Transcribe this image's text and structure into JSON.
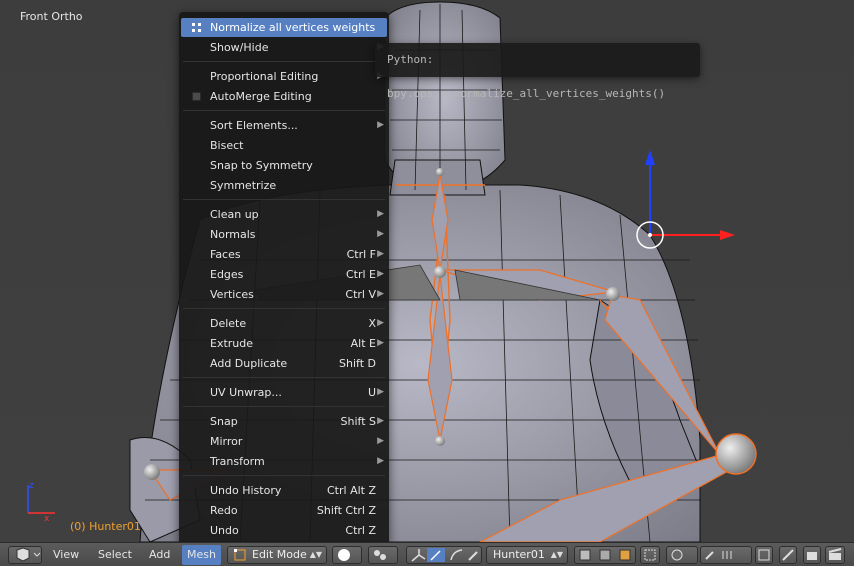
{
  "viewport": {
    "view_name": "Front Ortho",
    "object_label": "(0) Hunter01"
  },
  "menu": {
    "items": [
      {
        "label": "Normalize all vertices weights",
        "shortcut": "",
        "submenu": false,
        "highlighted": true,
        "icon": "vertex-group-icon"
      },
      {
        "label": "Show/Hide",
        "shortcut": "",
        "submenu": true
      },
      {
        "label": "Proportional Editing",
        "shortcut": "",
        "submenu": true
      },
      {
        "label": "AutoMerge Editing",
        "shortcut": "",
        "submenu": false,
        "icon": "checkbox-icon",
        "checked": false
      },
      {
        "label": "Sort Elements...",
        "shortcut": "",
        "submenu": true
      },
      {
        "label": "Bisect",
        "shortcut": "",
        "submenu": false
      },
      {
        "label": "Snap to Symmetry",
        "shortcut": "",
        "submenu": false
      },
      {
        "label": "Symmetrize",
        "shortcut": "",
        "submenu": false
      },
      {
        "label": "Clean up",
        "shortcut": "",
        "submenu": true
      },
      {
        "label": "Normals",
        "shortcut": "",
        "submenu": true
      },
      {
        "label": "Faces",
        "shortcut": "Ctrl F",
        "submenu": true
      },
      {
        "label": "Edges",
        "shortcut": "Ctrl E",
        "submenu": true
      },
      {
        "label": "Vertices",
        "shortcut": "Ctrl V",
        "submenu": true
      },
      {
        "label": "Delete",
        "shortcut": "X",
        "submenu": true
      },
      {
        "label": "Extrude",
        "shortcut": "Alt E",
        "submenu": true
      },
      {
        "label": "Add Duplicate",
        "shortcut": "Shift D",
        "submenu": false
      },
      {
        "label": "UV Unwrap...",
        "shortcut": "U",
        "submenu": true
      },
      {
        "label": "Snap",
        "shortcut": "Shift S",
        "submenu": true
      },
      {
        "label": "Mirror",
        "shortcut": "",
        "submenu": true
      },
      {
        "label": "Transform",
        "shortcut": "",
        "submenu": true
      },
      {
        "label": "Undo History",
        "shortcut": "Ctrl Alt Z",
        "submenu": false
      },
      {
        "label": "Redo",
        "shortcut": "Shift Ctrl Z",
        "submenu": false
      },
      {
        "label": "Undo",
        "shortcut": "Ctrl Z",
        "submenu": false
      }
    ]
  },
  "tooltip": {
    "text": "Python: bpy.ops.v.normalize_all_vertices_weights()"
  },
  "header": {
    "menus": [
      "View",
      "Select",
      "Add",
      "Mesh"
    ],
    "active_menu": "Mesh",
    "mode": "Edit Mode",
    "armature": "Hunter01"
  },
  "colors": {
    "accent": "#5680c2",
    "menu_bg": "#181818",
    "selection_orange": "#f07028",
    "mesh": "#9a9aaa"
  }
}
